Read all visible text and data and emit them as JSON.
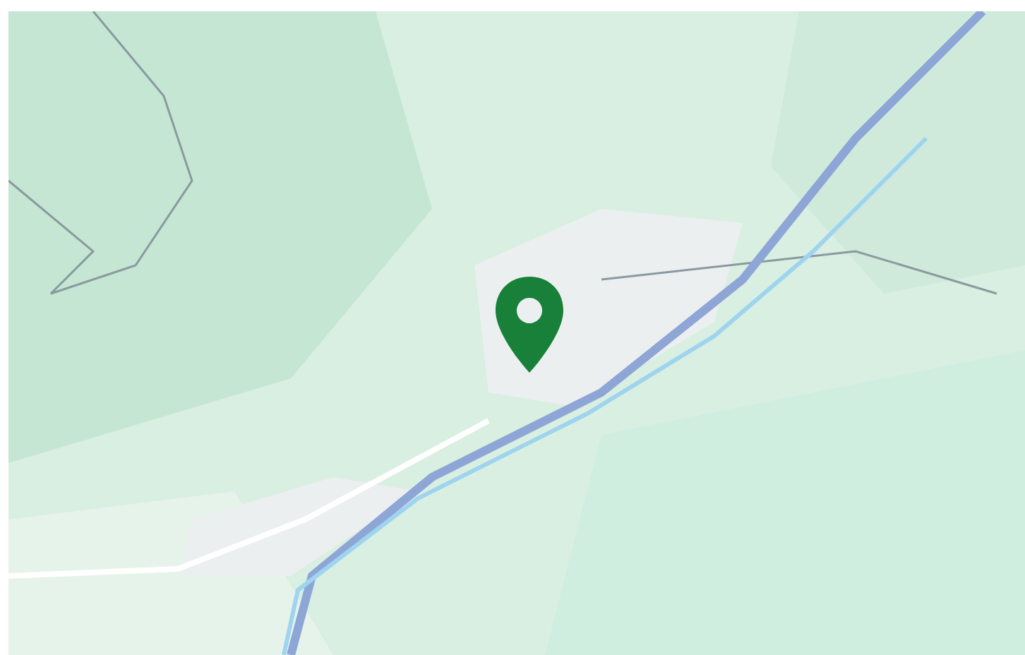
{
  "map": {
    "kind": "picture",
    "marker": {
      "kind": "pin",
      "color": "#188038"
    }
  }
}
